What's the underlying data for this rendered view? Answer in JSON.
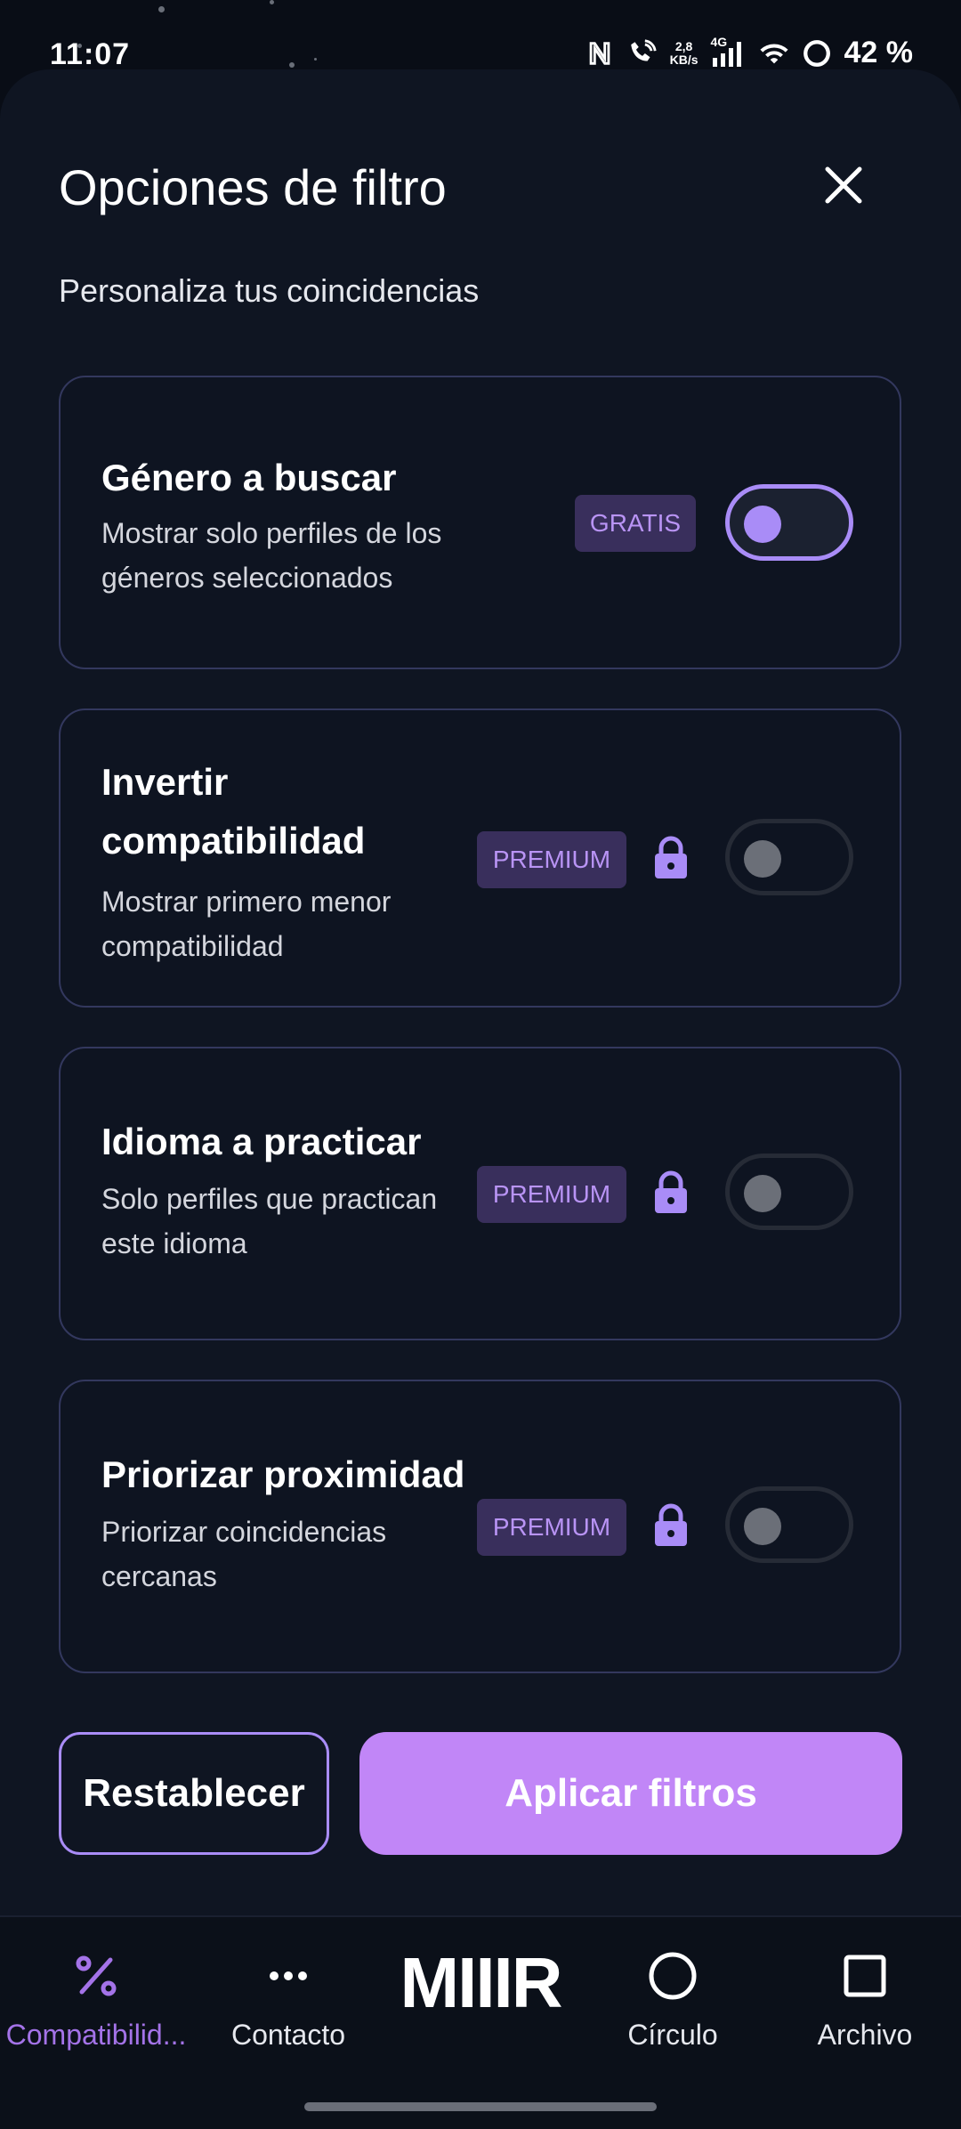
{
  "status_bar": {
    "time": "11:07",
    "net_speed_value": "2,8",
    "net_speed_unit": "KB/s",
    "network_type": "4G",
    "battery": "42 %"
  },
  "header": {
    "title": "Opciones de filtro",
    "subtitle": "Personaliza tus coincidencias"
  },
  "filters": [
    {
      "title": "Género a buscar",
      "description": "Mostrar solo perfiles de los géneros seleccionados",
      "badge": "GRATIS",
      "locked": false,
      "enabled": true
    },
    {
      "title": "Invertir compatibilidad",
      "description": "Mostrar primero menor compatibilidad",
      "badge": "PREMIUM",
      "locked": true,
      "enabled": false
    },
    {
      "title": "Idioma a practicar",
      "description": "Solo perfiles que practican este idioma",
      "badge": "PREMIUM",
      "locked": true,
      "enabled": false
    },
    {
      "title": "Priorizar proximidad",
      "description": "Priorizar coincidencias cercanas",
      "badge": "PREMIUM",
      "locked": true,
      "enabled": false
    }
  ],
  "actions": {
    "reset": "Restablecer",
    "apply": "Aplicar filtros"
  },
  "nav": {
    "items": [
      {
        "label": "Compatibilid...",
        "icon": "percent-icon",
        "active": true
      },
      {
        "label": "Contacto",
        "icon": "more-dots-icon",
        "active": false
      },
      {
        "label": "MIIIR",
        "icon": "logo",
        "active": false
      },
      {
        "label": "Círculo",
        "icon": "circle-icon",
        "active": false
      },
      {
        "label": "Archivo",
        "icon": "square-icon",
        "active": false
      }
    ]
  },
  "colors": {
    "accent": "#a98cf7",
    "apply_button": "#c186f7",
    "badge_bg": "#392f5c",
    "badge_text": "#b994f5",
    "background": "#090d16"
  }
}
